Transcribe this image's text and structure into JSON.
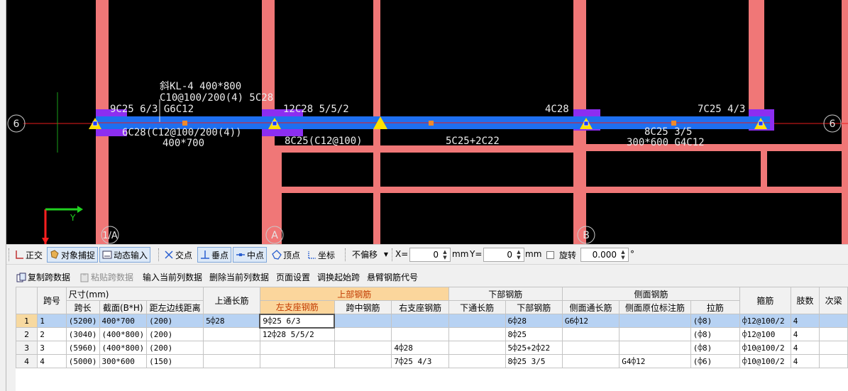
{
  "canvas": {
    "beam_title": "斜KL-4 400*800",
    "beam_stirrup": "C10@100/200(4) 5C28",
    "left_top": "9C25 6/3 G6C12",
    "left_bottom_1": "6C28(C12@100/200(4))",
    "left_bottom_2": "400*700",
    "span2_top": "12C28 5/5/2",
    "span2_bottom": "8C25(C12@100)",
    "span3_bottom": "5C25+2C22",
    "span3_top_right": "4C28",
    "span4_top_right": "7C25 4/3",
    "span4_bottom_1": "8C25 3/5",
    "span4_bottom_2": "300*600 G4C12",
    "axis_left": "6",
    "axis_right": "6",
    "axis_1a": "1/A",
    "axis_a": "A",
    "axis_b": "B",
    "ucs_y": "Y",
    "colors": {
      "column": "#f07777",
      "beam": "#1e6ff0",
      "support": "#8c2ef0",
      "triangle": "#ffe100",
      "axis_line": "#e81c1c",
      "ucs_x": "#ff2020",
      "ucs_y": "#20d020"
    }
  },
  "snap_toolbar": {
    "ortho": "正交",
    "object_snap": "对象捕捉",
    "dynamic_input": "动态输入",
    "intersection": "交点",
    "perpendicular": "垂点",
    "midpoint": "中点",
    "vertex": "顶点",
    "coordinate": "坐标",
    "offset_mode": "不偏移",
    "x_label": "X=",
    "x_value": "0",
    "unit1": "mm",
    "y_label": "Y=",
    "y_value": "0",
    "unit2": "mm",
    "rotate_label": "旋转",
    "rotate_value": "0.000",
    "degree": "°"
  },
  "table_toolbar": {
    "copy_span": "复制跨数据",
    "paste_span": "粘贴跨数据",
    "input_column": "输入当前列数据",
    "delete_column": "删除当前列数据",
    "page_setup": "页面设置",
    "swap_start": "调换起始跨",
    "cantilever_code": "悬臂钢筋代号"
  },
  "grid": {
    "headers": {
      "span_no": "跨号",
      "size_group": "尺寸(mm)",
      "span_length": "跨长",
      "section": "截面(B*H)",
      "left_dist": "距左边线距离",
      "top_through": "上通长筋",
      "top_group": "上部钢筋",
      "left_support": "左支座钢筋",
      "mid_span": "跨中钢筋",
      "right_support": "右支座钢筋",
      "bottom_group": "下部钢筋",
      "bottom_through": "下通长筋",
      "bottom_bars": "下部钢筋",
      "side_group": "侧面钢筋",
      "side_through": "侧面通长筋",
      "side_original": "侧面原位标注筋",
      "tie_bars": "拉筋",
      "stirrup": "箍筋",
      "legs": "肢数",
      "secondary": "次梁"
    },
    "rows": [
      {
        "row": "1",
        "span": "1",
        "length": "(5200)",
        "section": "400*700",
        "dist": "(200)",
        "top_through": "5⌽28",
        "left": "9⌽25 6/3",
        "mid": "",
        "right": "",
        "bot_through": "",
        "bottom": "6⌽28",
        "side_through": "G6⌽12",
        "side_orig": "",
        "tie": "(⌽8)",
        "stirrup": "⌽12@100/2",
        "legs": "4"
      },
      {
        "row": "2",
        "span": "2",
        "length": "(3040)",
        "section": "(400*800)",
        "dist": "(200)",
        "top_through": "",
        "left": "12⌽28 5/5/2",
        "mid": "",
        "right": "",
        "bot_through": "",
        "bottom": "8⌽25",
        "side_through": "",
        "side_orig": "",
        "tie": "(⌽8)",
        "stirrup": "⌽12@100",
        "legs": "4"
      },
      {
        "row": "3",
        "span": "3",
        "length": "(5960)",
        "section": "(400*800)",
        "dist": "(200)",
        "top_through": "",
        "left": "",
        "mid": "",
        "right": "4⌽28",
        "bot_through": "",
        "bottom": "5⌽25+2⌽22",
        "side_through": "",
        "side_orig": "",
        "tie": "(⌽8)",
        "stirrup": "⌽10@100/2",
        "legs": "4"
      },
      {
        "row": "4",
        "span": "4",
        "length": "(5000)",
        "section": "300*600",
        "dist": "(150)",
        "top_through": "",
        "left": "",
        "mid": "",
        "right": "7⌽25 4/3",
        "bot_through": "",
        "bottom": "8⌽25 3/5",
        "side_through": "",
        "side_orig": "G4⌽12",
        "tie": "(⌽6)",
        "stirrup": "⌽10@100/2",
        "legs": "4"
      }
    ]
  }
}
